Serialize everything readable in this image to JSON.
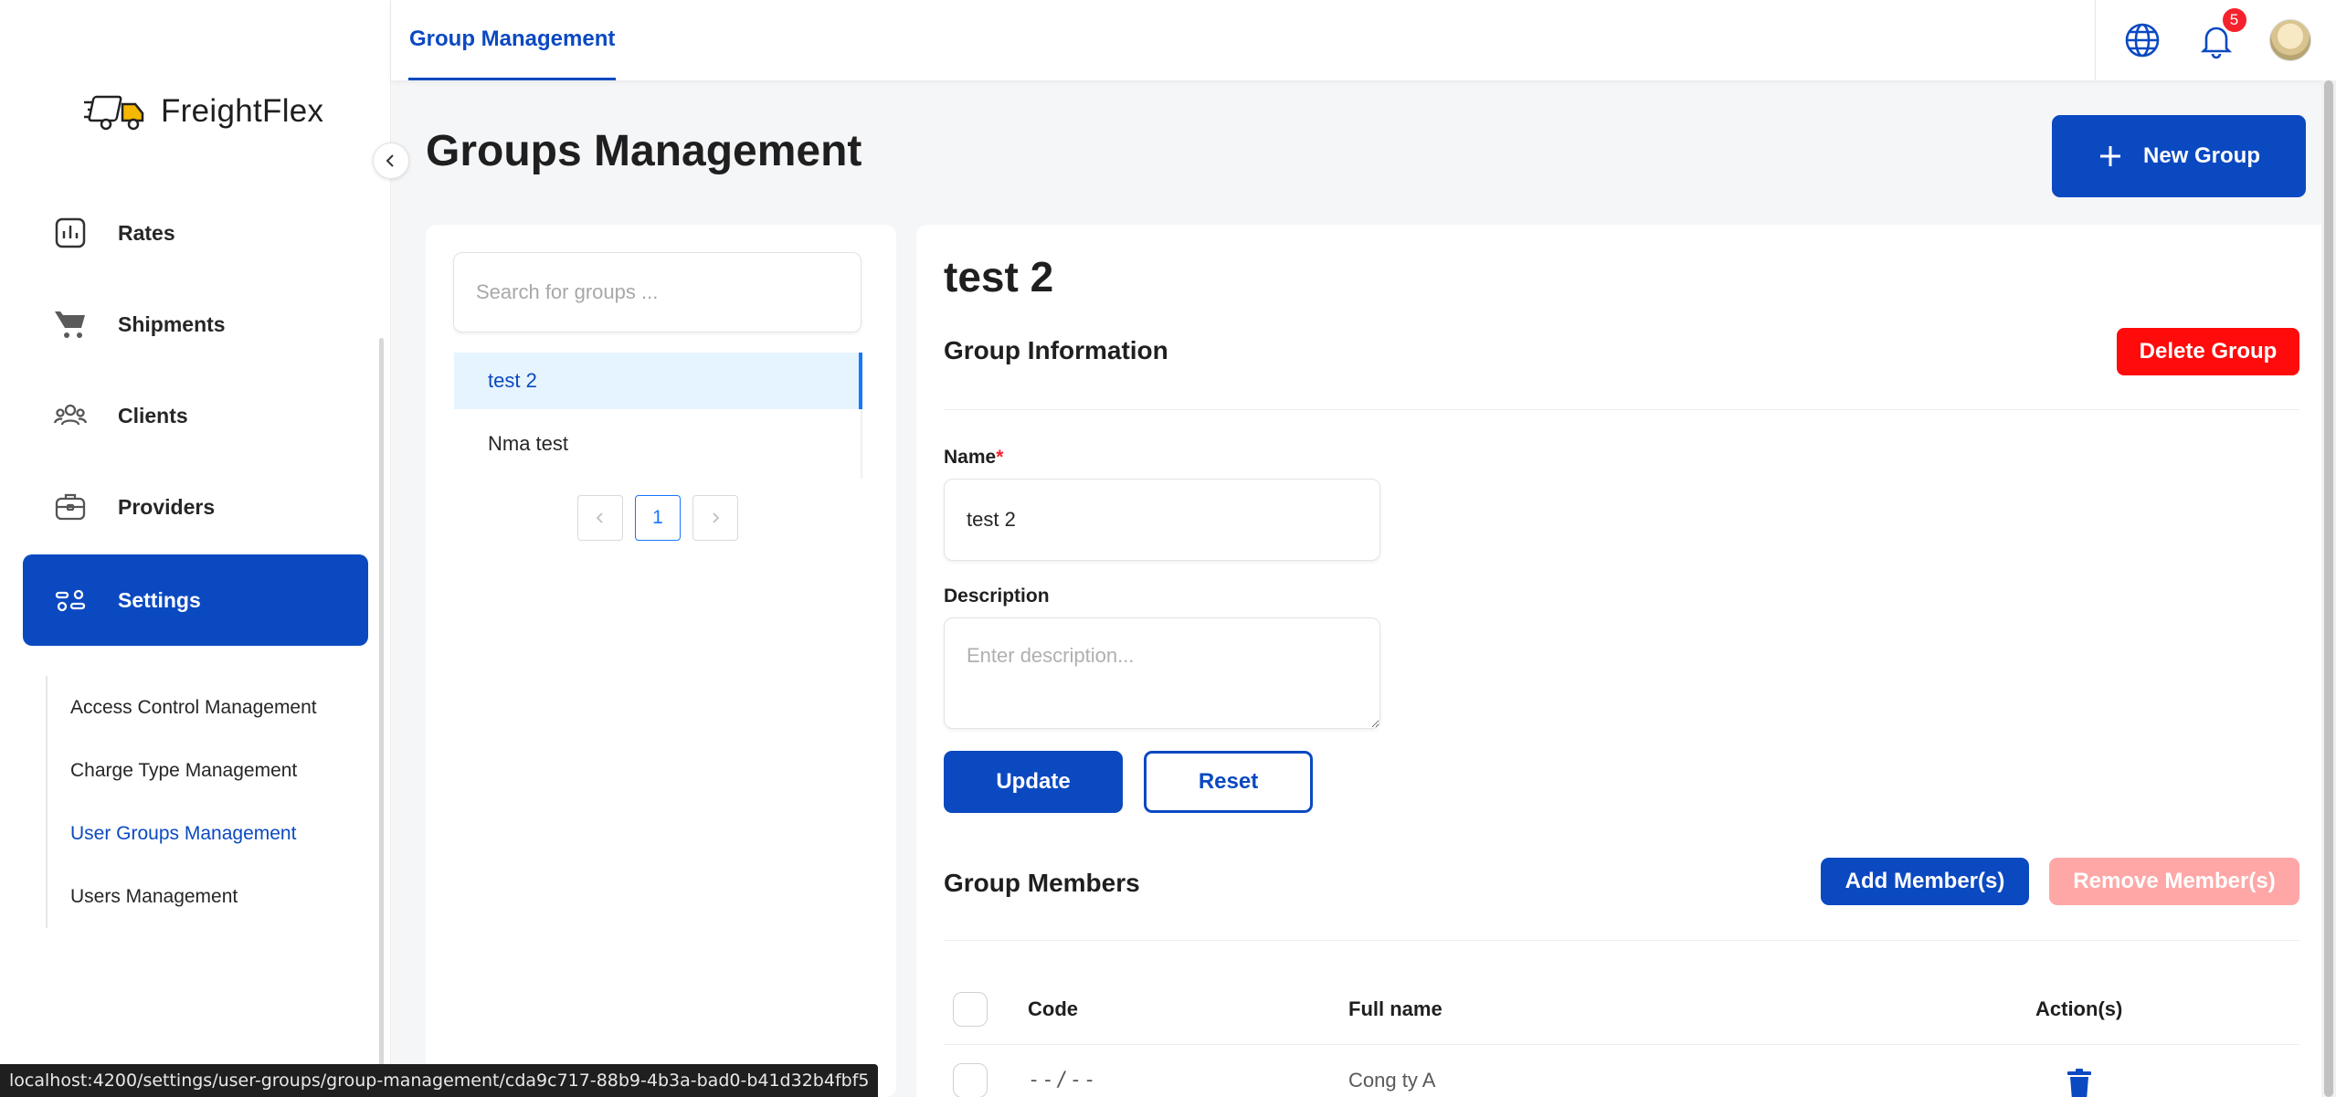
{
  "app": {
    "name": "FreightFlex"
  },
  "sidebar": {
    "nav": [
      {
        "label": "Rates",
        "icon": "bar-chart-icon"
      },
      {
        "label": "Shipments",
        "icon": "cart-icon"
      },
      {
        "label": "Clients",
        "icon": "users-icon"
      },
      {
        "label": "Providers",
        "icon": "briefcase-icon"
      },
      {
        "label": "Settings",
        "icon": "settings-sliders-icon",
        "active": true
      }
    ],
    "submenu": [
      {
        "label": "Access Control Management"
      },
      {
        "label": "Charge Type Management"
      },
      {
        "label": "User Groups Management",
        "active": true
      },
      {
        "label": "Users Management"
      }
    ]
  },
  "topbar": {
    "tab": "Group Management",
    "notification_count": "5"
  },
  "page": {
    "title": "Groups Management",
    "new_group_label": "New Group"
  },
  "groups_panel": {
    "search_placeholder": "Search for groups ...",
    "items": [
      {
        "label": "test 2",
        "selected": true
      },
      {
        "label": "Nma test"
      }
    ],
    "pagination": {
      "current": "1"
    }
  },
  "detail": {
    "title": "test 2",
    "info_title": "Group Information",
    "delete_label": "Delete Group",
    "name_label": "Name",
    "name_required": "*",
    "name_value": "test 2",
    "description_label": "Description",
    "description_placeholder": "Enter description...",
    "update_label": "Update",
    "reset_label": "Reset",
    "members_title": "Group Members",
    "add_member_label": "Add Member(s)",
    "remove_member_label": "Remove Member(s)",
    "table": {
      "headers": {
        "code": "Code",
        "full_name": "Full name",
        "actions": "Action(s)"
      },
      "rows": [
        {
          "code": "--/--",
          "full_name": "Cong ty A"
        }
      ]
    }
  },
  "status_url": "localhost:4200/settings/user-groups/group-management/cda9c717-88b9-4b3a-bad0-b41d32b4fbf5",
  "colors": {
    "primary": "#0b49c1",
    "danger": "#ff0b0b",
    "danger_disabled": "#ffa7a7",
    "selected_bg": "#e6f4ff"
  }
}
